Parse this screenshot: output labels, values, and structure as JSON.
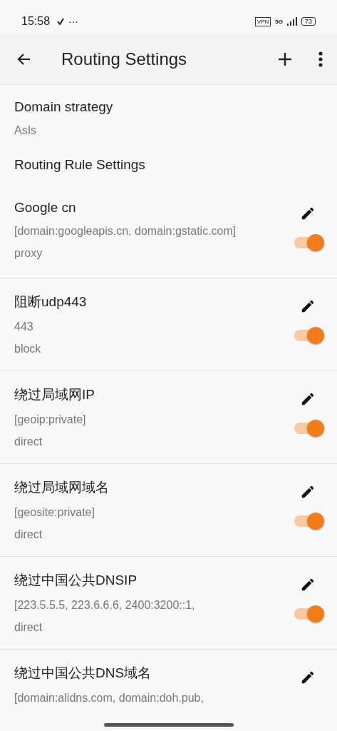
{
  "status_bar": {
    "time": "15:58",
    "dots": "···",
    "vpn": "VPN",
    "network": "5G",
    "battery": "73"
  },
  "app_bar": {
    "title": "Routing Settings"
  },
  "domain_strategy": {
    "label": "Domain strategy",
    "value": "AsIs"
  },
  "section_title": "Routing Rule Settings",
  "rules": [
    {
      "title": "Google cn",
      "rule": "[domain:googleapis.cn, domain:gstatic.com]",
      "outbound": "proxy",
      "enabled": true
    },
    {
      "title": "阻断udp443",
      "rule": "443",
      "outbound": "block",
      "enabled": true
    },
    {
      "title": "绕过局域网IP",
      "rule": "[geoip:private]",
      "outbound": "direct",
      "enabled": true
    },
    {
      "title": "绕过局域网域名",
      "rule": "[geosite:private]",
      "outbound": "direct",
      "enabled": true
    },
    {
      "title": "绕过中国公共DNSIP",
      "rule": "[223.5.5.5, 223.6.6.6, 2400:3200::1,",
      "outbound": "direct",
      "enabled": true
    },
    {
      "title": "绕过中国公共DNS域名",
      "rule": "[domain:alidns.com, domain:doh.pub,"
    }
  ]
}
